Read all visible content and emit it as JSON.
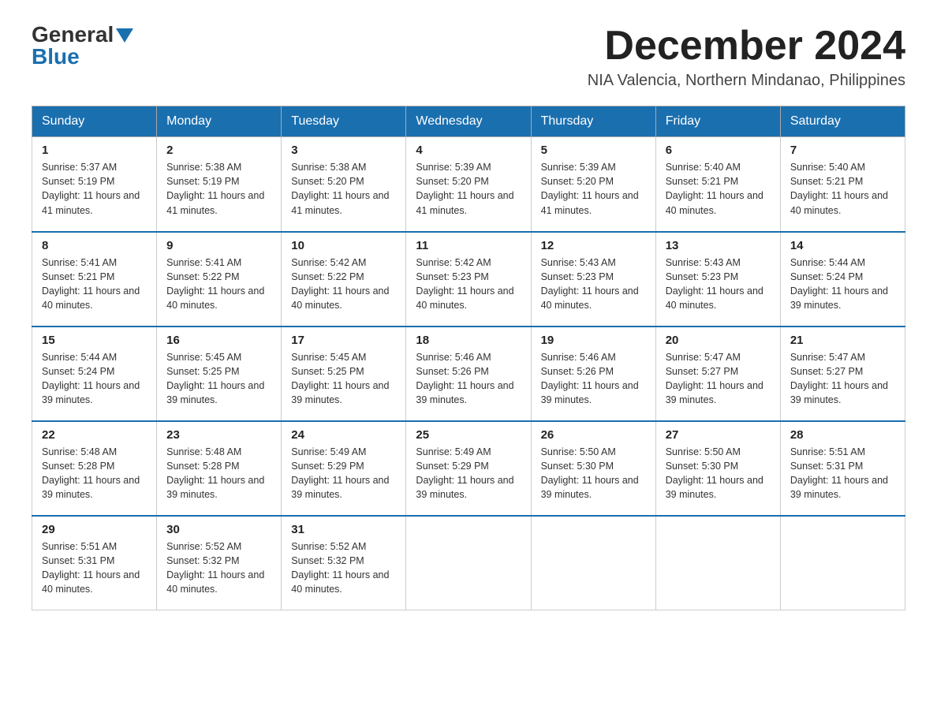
{
  "logo": {
    "general": "General",
    "blue": "Blue"
  },
  "title": "December 2024",
  "subtitle": "NIA Valencia, Northern Mindanao, Philippines",
  "days_of_week": [
    "Sunday",
    "Monday",
    "Tuesday",
    "Wednesday",
    "Thursday",
    "Friday",
    "Saturday"
  ],
  "weeks": [
    [
      {
        "day": "1",
        "sunrise": "5:37 AM",
        "sunset": "5:19 PM",
        "daylight": "11 hours and 41 minutes."
      },
      {
        "day": "2",
        "sunrise": "5:38 AM",
        "sunset": "5:19 PM",
        "daylight": "11 hours and 41 minutes."
      },
      {
        "day": "3",
        "sunrise": "5:38 AM",
        "sunset": "5:20 PM",
        "daylight": "11 hours and 41 minutes."
      },
      {
        "day": "4",
        "sunrise": "5:39 AM",
        "sunset": "5:20 PM",
        "daylight": "11 hours and 41 minutes."
      },
      {
        "day": "5",
        "sunrise": "5:39 AM",
        "sunset": "5:20 PM",
        "daylight": "11 hours and 41 minutes."
      },
      {
        "day": "6",
        "sunrise": "5:40 AM",
        "sunset": "5:21 PM",
        "daylight": "11 hours and 40 minutes."
      },
      {
        "day": "7",
        "sunrise": "5:40 AM",
        "sunset": "5:21 PM",
        "daylight": "11 hours and 40 minutes."
      }
    ],
    [
      {
        "day": "8",
        "sunrise": "5:41 AM",
        "sunset": "5:21 PM",
        "daylight": "11 hours and 40 minutes."
      },
      {
        "day": "9",
        "sunrise": "5:41 AM",
        "sunset": "5:22 PM",
        "daylight": "11 hours and 40 minutes."
      },
      {
        "day": "10",
        "sunrise": "5:42 AM",
        "sunset": "5:22 PM",
        "daylight": "11 hours and 40 minutes."
      },
      {
        "day": "11",
        "sunrise": "5:42 AM",
        "sunset": "5:23 PM",
        "daylight": "11 hours and 40 minutes."
      },
      {
        "day": "12",
        "sunrise": "5:43 AM",
        "sunset": "5:23 PM",
        "daylight": "11 hours and 40 minutes."
      },
      {
        "day": "13",
        "sunrise": "5:43 AM",
        "sunset": "5:23 PM",
        "daylight": "11 hours and 40 minutes."
      },
      {
        "day": "14",
        "sunrise": "5:44 AM",
        "sunset": "5:24 PM",
        "daylight": "11 hours and 39 minutes."
      }
    ],
    [
      {
        "day": "15",
        "sunrise": "5:44 AM",
        "sunset": "5:24 PM",
        "daylight": "11 hours and 39 minutes."
      },
      {
        "day": "16",
        "sunrise": "5:45 AM",
        "sunset": "5:25 PM",
        "daylight": "11 hours and 39 minutes."
      },
      {
        "day": "17",
        "sunrise": "5:45 AM",
        "sunset": "5:25 PM",
        "daylight": "11 hours and 39 minutes."
      },
      {
        "day": "18",
        "sunrise": "5:46 AM",
        "sunset": "5:26 PM",
        "daylight": "11 hours and 39 minutes."
      },
      {
        "day": "19",
        "sunrise": "5:46 AM",
        "sunset": "5:26 PM",
        "daylight": "11 hours and 39 minutes."
      },
      {
        "day": "20",
        "sunrise": "5:47 AM",
        "sunset": "5:27 PM",
        "daylight": "11 hours and 39 minutes."
      },
      {
        "day": "21",
        "sunrise": "5:47 AM",
        "sunset": "5:27 PM",
        "daylight": "11 hours and 39 minutes."
      }
    ],
    [
      {
        "day": "22",
        "sunrise": "5:48 AM",
        "sunset": "5:28 PM",
        "daylight": "11 hours and 39 minutes."
      },
      {
        "day": "23",
        "sunrise": "5:48 AM",
        "sunset": "5:28 PM",
        "daylight": "11 hours and 39 minutes."
      },
      {
        "day": "24",
        "sunrise": "5:49 AM",
        "sunset": "5:29 PM",
        "daylight": "11 hours and 39 minutes."
      },
      {
        "day": "25",
        "sunrise": "5:49 AM",
        "sunset": "5:29 PM",
        "daylight": "11 hours and 39 minutes."
      },
      {
        "day": "26",
        "sunrise": "5:50 AM",
        "sunset": "5:30 PM",
        "daylight": "11 hours and 39 minutes."
      },
      {
        "day": "27",
        "sunrise": "5:50 AM",
        "sunset": "5:30 PM",
        "daylight": "11 hours and 39 minutes."
      },
      {
        "day": "28",
        "sunrise": "5:51 AM",
        "sunset": "5:31 PM",
        "daylight": "11 hours and 39 minutes."
      }
    ],
    [
      {
        "day": "29",
        "sunrise": "5:51 AM",
        "sunset": "5:31 PM",
        "daylight": "11 hours and 40 minutes."
      },
      {
        "day": "30",
        "sunrise": "5:52 AM",
        "sunset": "5:32 PM",
        "daylight": "11 hours and 40 minutes."
      },
      {
        "day": "31",
        "sunrise": "5:52 AM",
        "sunset": "5:32 PM",
        "daylight": "11 hours and 40 minutes."
      },
      null,
      null,
      null,
      null
    ]
  ],
  "labels": {
    "sunrise_prefix": "Sunrise: ",
    "sunset_prefix": "Sunset: ",
    "daylight_prefix": "Daylight: "
  }
}
